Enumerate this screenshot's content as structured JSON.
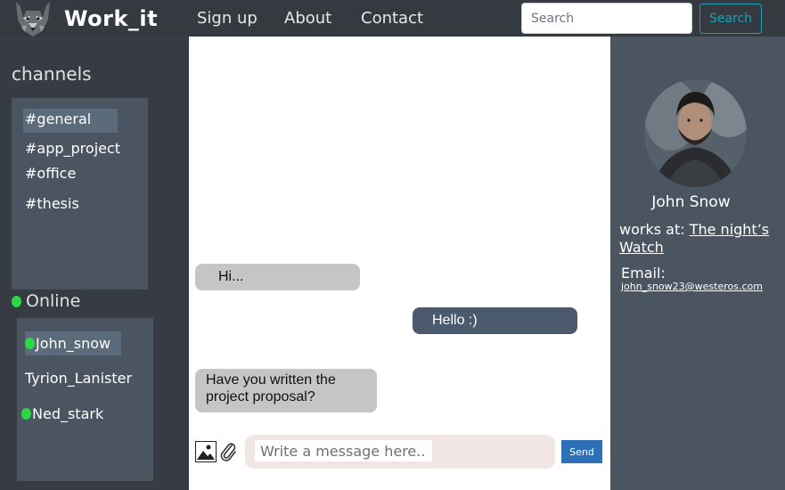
{
  "navbar": {
    "logo_icon": "wolf-logo-icon",
    "brand": "Work_it",
    "links": [
      "Sign up",
      "About",
      "Contact"
    ],
    "search_placeholder": "Search",
    "search_button": "Search"
  },
  "sidebar": {
    "channels_title": "channels",
    "channels": [
      "#general",
      "#app_project",
      "#office",
      "#thesis"
    ],
    "active_channel": "#general",
    "online_title": "Online",
    "users": [
      {
        "name": "John_snow",
        "online": true
      },
      {
        "name": "Tyrion_Lanister",
        "online": false
      },
      {
        "name": "Ned_stark",
        "online": true
      }
    ],
    "online_color": "#2bd946"
  },
  "chat": {
    "messages": [
      {
        "text": "Hi...",
        "direction": "incoming"
      },
      {
        "text": "Hello :)",
        "direction": "outgoing"
      },
      {
        "text": "Have you written the project proposal?",
        "direction": "incoming"
      }
    ],
    "composer_placeholder": "Write a message here...",
    "send_label": "Send",
    "attach_image_icon": "image-icon",
    "attach_file_icon": "paperclip-icon"
  },
  "profile": {
    "avatar_icon": "profile-photo",
    "name": "John Snow",
    "works_at_label": "works at:",
    "works_at_value": "The night’s Watch",
    "email_label": "Email:",
    "email": "john_snow23@westeros.com"
  },
  "colors": {
    "navbar_bg": "#343a40",
    "sidebar_bg": "#373c44",
    "panel_bg": "#4b5562",
    "incoming_bubble": "#c5c5c5",
    "outgoing_bubble": "#4b5b6d",
    "send_button": "#2e70b8",
    "search_button": "#17a2b8"
  }
}
